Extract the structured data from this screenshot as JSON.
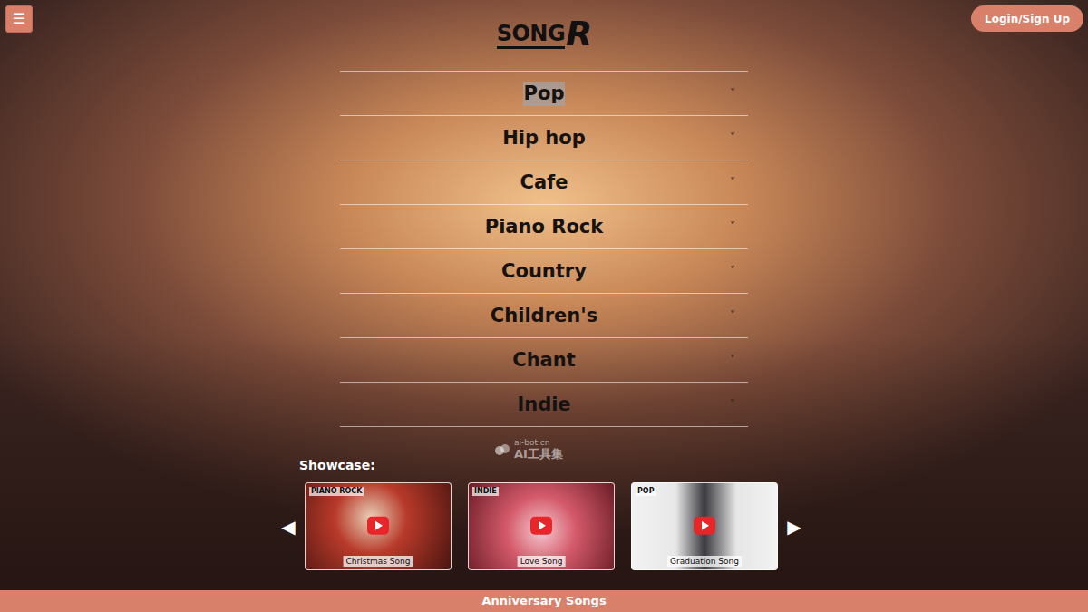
{
  "menu_button": {
    "label": "☰"
  },
  "login_button": {
    "label": "Login/Sign Up"
  },
  "logo": {
    "text": "SONG",
    "mark": "R"
  },
  "genres": [
    {
      "label": "Pop",
      "selected": true,
      "expanded": false,
      "chevron": "˅"
    },
    {
      "label": "Hip hop",
      "selected": false,
      "expanded": false,
      "chevron": "˅"
    },
    {
      "label": "Cafe",
      "selected": false,
      "expanded": false,
      "chevron": "˅"
    },
    {
      "label": "Piano Rock",
      "selected": false,
      "expanded": false,
      "chevron": "˅"
    },
    {
      "label": "Country",
      "selected": false,
      "expanded": false,
      "chevron": "˅"
    },
    {
      "label": "Children's",
      "selected": false,
      "expanded": false,
      "chevron": "˅"
    },
    {
      "label": "Chant",
      "selected": false,
      "expanded": false,
      "chevron": "˅"
    },
    {
      "label": "Indie",
      "selected": false,
      "expanded": false,
      "chevron": "˅"
    }
  ],
  "showcase": {
    "title": "Showcase:",
    "prev": "◀",
    "next": "▶",
    "cards": [
      {
        "genre": "PIANO ROCK",
        "title": "Christmas Song"
      },
      {
        "genre": "INDIE",
        "title": "Love Song"
      },
      {
        "genre": "POP",
        "title": "Graduation Song"
      }
    ]
  },
  "watermark": {
    "domain": "ai-bot.cn",
    "name": "AI工具集"
  },
  "footer": {
    "label": "Anniversary Songs"
  }
}
